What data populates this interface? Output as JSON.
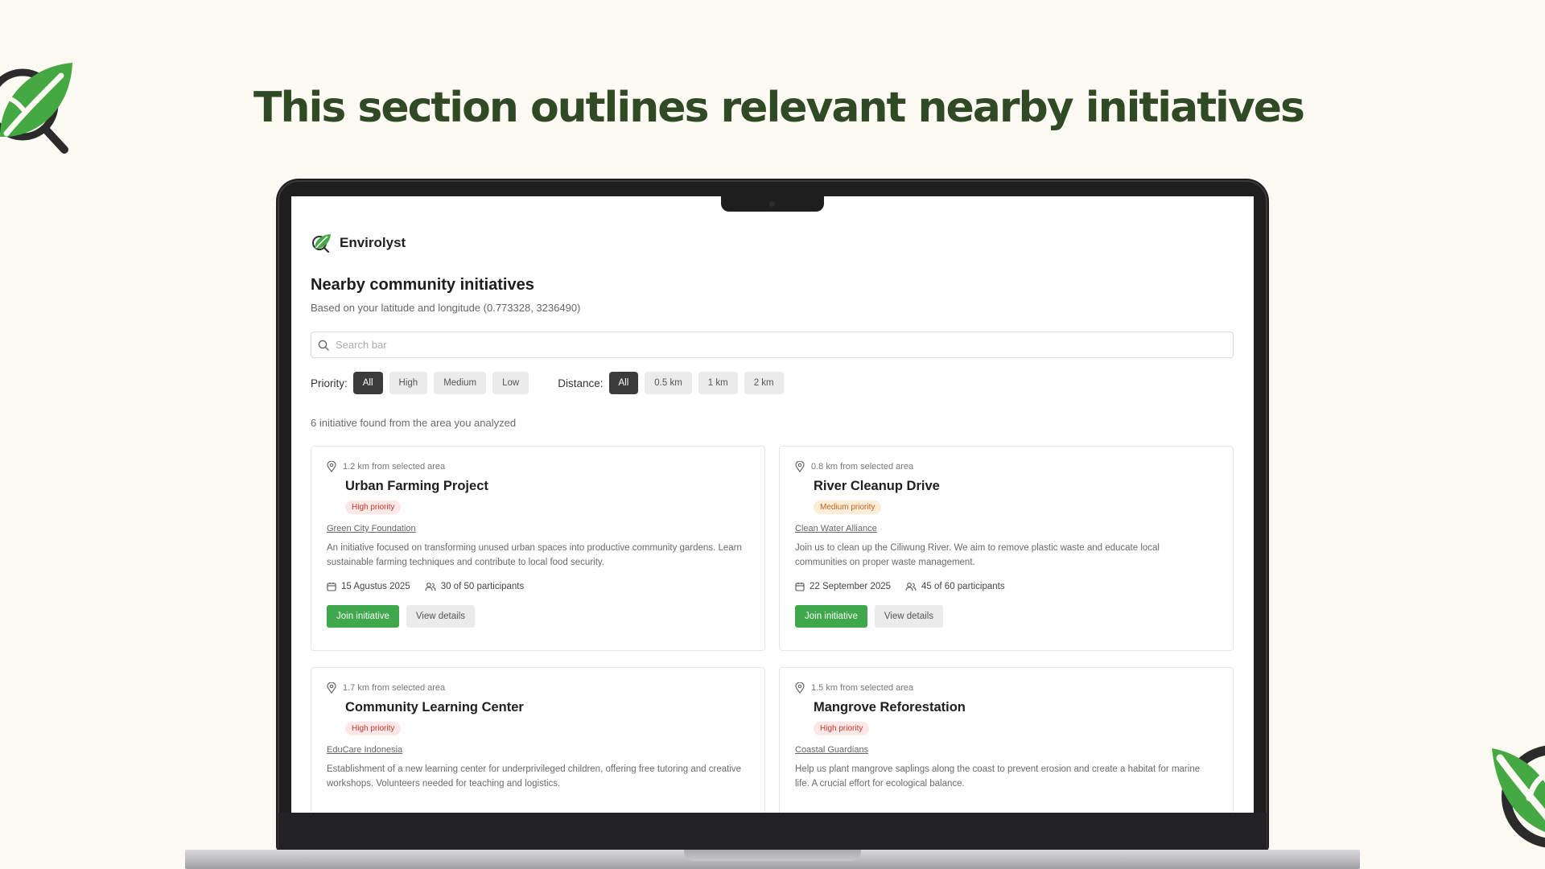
{
  "headline": "This section outlines relevant nearby initiatives",
  "app": {
    "brand_name": "Envirolyst",
    "page_title": "Nearby community initiatives",
    "subtitle": "Based on your latitude and longitude (0.773328, 3236490)"
  },
  "search": {
    "placeholder": "Search bar",
    "value": ""
  },
  "filters": {
    "priority_label": "Priority:",
    "priority_options": [
      "All",
      "High",
      "Medium",
      "Low"
    ],
    "priority_selected": "All",
    "distance_label": "Distance:",
    "distance_options": [
      "All",
      "0.5 km",
      "1 km",
      "2 km"
    ],
    "distance_selected": "All"
  },
  "result_count": "6 initiative found from the area you analyzed",
  "initiatives": [
    {
      "distance": "1.2 km from selected area",
      "title": "Urban Farming Project",
      "priority": "High priority",
      "organization": "Green City Foundation",
      "description": "An initiative focused on transforming unused urban spaces into productive community gardens. Learn sustainable farming techniques and contribute to local food security.",
      "date": "15 Agustus 2025",
      "participants": "30 of 50 participants",
      "join_label": "Join initiative",
      "details_label": "View details"
    },
    {
      "distance": "0.8 km from selected area",
      "title": "River Cleanup Drive",
      "priority": "Medium priority",
      "organization": "Clean Water Alliance",
      "description": "Join us to clean up the Ciliwung River. We aim to remove plastic waste and educate local communities on proper waste management.",
      "date": "22 September 2025",
      "participants": "45 of 60 participants",
      "join_label": "Join initiative",
      "details_label": "View details"
    },
    {
      "distance": "1.7 km from selected area",
      "title": "Community Learning Center",
      "priority": "High priority",
      "organization": "EduCare Indonesia",
      "description": "Establishment of a new learning center for underprivileged children, offering free tutoring and creative workshops. Volunteers needed for teaching and logistics.",
      "date": "",
      "participants": "",
      "join_label": "",
      "details_label": ""
    },
    {
      "distance": "1.5 km from selected area",
      "title": "Mangrove Reforestation",
      "priority": "High priority",
      "organization": "Coastal Guardians",
      "description": "Help us plant mangrove saplings along the coast to prevent erosion and create a habitat for marine life. A crucial effort for ecological balance.",
      "date": "",
      "participants": "",
      "join_label": "",
      "details_label": ""
    }
  ],
  "colors": {
    "headline": "#2f4a24",
    "accent_green": "#3fa84a",
    "chip_active": "#3b3b3b",
    "high_badge_bg": "#fde7e7",
    "medium_badge_bg": "#fdecd8"
  },
  "icons": [
    "leaf-search-logo",
    "search-icon",
    "location-pin-icon",
    "calendar-icon",
    "users-icon"
  ]
}
